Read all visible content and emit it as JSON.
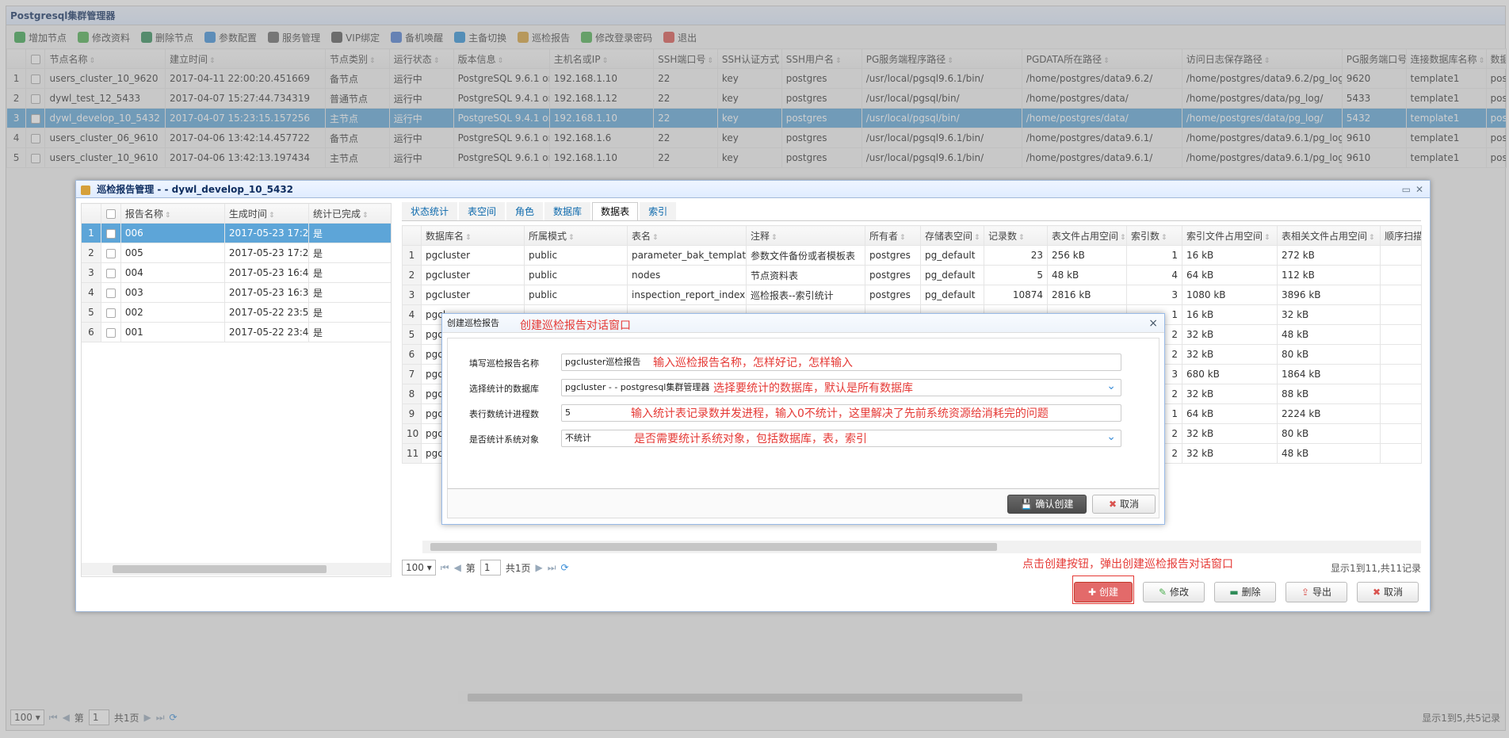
{
  "app": {
    "title": "Postgresql集群管理器"
  },
  "toolbar": [
    {
      "label": "增加节点",
      "icon": "add-icon",
      "color": "#3aa64f"
    },
    {
      "label": "修改资料",
      "icon": "pencil-icon",
      "color": "#4caf50"
    },
    {
      "label": "删除节点",
      "icon": "remove-icon",
      "color": "#2e8b57"
    },
    {
      "label": "参数配置",
      "icon": "gear-icon",
      "color": "#3b8ed8"
    },
    {
      "label": "服务管理",
      "icon": "server-icon",
      "color": "#666666"
    },
    {
      "label": "VIP绑定",
      "icon": "pin-icon",
      "color": "#555555"
    },
    {
      "label": "备机唤醒",
      "icon": "lamp-icon",
      "color": "#4a7bd0"
    },
    {
      "label": "主备切换",
      "icon": "switch-icon",
      "color": "#2b8fd6"
    },
    {
      "label": "巡检报告",
      "icon": "report-icon",
      "color": "#d6a03a"
    },
    {
      "label": "修改登录密码",
      "icon": "check-icon",
      "color": "#4caf50"
    },
    {
      "label": "退出",
      "icon": "exit-icon",
      "color": "#d9534f"
    }
  ],
  "node_grid": {
    "columns": [
      "节点名称",
      "建立时间",
      "节点类别",
      "运行状态",
      "版本信息",
      "主机名或IP",
      "SSH端口号",
      "SSH认证方式",
      "SSH用户名",
      "PG服务端程序路径",
      "PGDATA所在路径",
      "访问日志保存路径",
      "PG服务端口号",
      "连接数据库名称",
      "数据"
    ],
    "rows": [
      {
        "n": "1",
        "cells": [
          "users_cluster_10_9620",
          "2017-04-11 22:00:20.451669",
          "备节点",
          "运行中",
          "PostgreSQL 9.6.1 on",
          "192.168.1.10",
          "22",
          "key",
          "postgres",
          "/usr/local/pgsql9.6.1/bin/",
          "/home/postgres/data9.6.2/",
          "/home/postgres/data9.6.2/pg_log",
          "9620",
          "template1",
          "post"
        ]
      },
      {
        "n": "2",
        "cells": [
          "dywl_test_12_5433",
          "2017-04-07 15:27:44.734319",
          "普通节点",
          "运行中",
          "PostgreSQL 9.4.1 on",
          "192.168.1.12",
          "22",
          "key",
          "postgres",
          "/usr/local/pgsql/bin/",
          "/home/postgres/data/",
          "/home/postgres/data/pg_log/",
          "5433",
          "template1",
          "post"
        ]
      },
      {
        "n": "3",
        "cells": [
          "dywl_develop_10_5432",
          "2017-04-07 15:23:15.157256",
          "主节点",
          "运行中",
          "PostgreSQL 9.4.1 on",
          "192.168.1.10",
          "22",
          "key",
          "postgres",
          "/usr/local/pgsql/bin/",
          "/home/postgres/data/",
          "/home/postgres/data/pg_log/",
          "5432",
          "template1",
          "post"
        ]
      },
      {
        "n": "4",
        "cells": [
          "users_cluster_06_9610",
          "2017-04-06 13:42:14.457722",
          "备节点",
          "运行中",
          "PostgreSQL 9.6.1 on",
          "192.168.1.6",
          "22",
          "key",
          "postgres",
          "/usr/local/pgsql9.6.1/bin/",
          "/home/postgres/data9.6.1/",
          "/home/postgres/data9.6.1/pg_log",
          "9610",
          "template1",
          "post"
        ]
      },
      {
        "n": "5",
        "cells": [
          "users_cluster_10_9610",
          "2017-04-06 13:42:13.197434",
          "主节点",
          "运行中",
          "PostgreSQL 9.6.1 on",
          "192.168.1.10",
          "22",
          "key",
          "postgres",
          "/usr/local/pgsql9.6.1/bin/",
          "/home/postgres/data9.6.1/",
          "/home/postgres/data9.6.1/pg_log",
          "9610",
          "template1",
          "post"
        ]
      }
    ]
  },
  "bottom_pager": {
    "page_size": "100",
    "page_prefix": "第",
    "page": "1",
    "page_suffix": "共1页",
    "summary": "显示1到5,共5记录"
  },
  "report_panel": {
    "title": "巡检报告管理 -  - dywl_develop_10_5432",
    "report_columns": [
      "报告名称",
      "生成时间",
      "统计已完成"
    ],
    "reports": [
      {
        "n": "1",
        "name": "006",
        "time": "2017-05-23 17:2",
        "done": "是"
      },
      {
        "n": "2",
        "name": "005",
        "time": "2017-05-23 17:2",
        "done": "是"
      },
      {
        "n": "3",
        "name": "004",
        "time": "2017-05-23 16:4",
        "done": "是"
      },
      {
        "n": "4",
        "name": "003",
        "time": "2017-05-23 16:3",
        "done": "是"
      },
      {
        "n": "5",
        "name": "002",
        "time": "2017-05-22 23:5",
        "done": "是"
      },
      {
        "n": "6",
        "name": "001",
        "time": "2017-05-22 23:4",
        "done": "是"
      }
    ],
    "tabs": [
      "状态统计",
      "表空间",
      "角色",
      "数据库",
      "数据表",
      "索引"
    ],
    "active_tab": 4,
    "table_columns": [
      "数据库名",
      "所属模式",
      "表名",
      "注释",
      "所有者",
      "存储表空间",
      "记录数",
      "表文件占用空间",
      "索引数",
      "索引文件占用空间",
      "表相关文件占用空间",
      "顺序扫描次"
    ],
    "tables": [
      {
        "n": "1",
        "cells": [
          "pgcluster",
          "public",
          "parameter_bak_template",
          "参数文件备份或者模板表",
          "postgres",
          "pg_default",
          "23",
          "256 kB",
          "1",
          "16 kB",
          "272 kB",
          ""
        ]
      },
      {
        "n": "2",
        "cells": [
          "pgcluster",
          "public",
          "nodes",
          "节点资料表",
          "postgres",
          "pg_default",
          "5",
          "48 kB",
          "4",
          "64 kB",
          "112 kB",
          ""
        ]
      },
      {
        "n": "3",
        "cells": [
          "pgcluster",
          "public",
          "inspection_report_index",
          "巡检报表--索引统计",
          "postgres",
          "pg_default",
          "10874",
          "2816 kB",
          "3",
          "1080 kB",
          "3896 kB",
          ""
        ]
      },
      {
        "n": "4",
        "cells": [
          "pgcl",
          "",
          "",
          "",
          "",
          "",
          "",
          "",
          "1",
          "16 kB",
          "32 kB",
          ""
        ]
      },
      {
        "n": "5",
        "cells": [
          "pgc",
          "",
          "",
          "",
          "",
          "",
          "",
          "",
          "2",
          "32 kB",
          "48 kB",
          ""
        ]
      },
      {
        "n": "6",
        "cells": [
          "pgc",
          "",
          "",
          "",
          "",
          "",
          "",
          "",
          "2",
          "32 kB",
          "80 kB",
          ""
        ]
      },
      {
        "n": "7",
        "cells": [
          "pgc",
          "",
          "",
          "",
          "",
          "",
          "",
          "",
          "3",
          "680 kB",
          "1864 kB",
          ""
        ]
      },
      {
        "n": "8",
        "cells": [
          "pgc",
          "",
          "",
          "",
          "",
          "",
          "",
          "",
          "2",
          "32 kB",
          "88 kB",
          ""
        ]
      },
      {
        "n": "9",
        "cells": [
          "pgc",
          "",
          "",
          "",
          "",
          "",
          "",
          "",
          "1",
          "64 kB",
          "2224 kB",
          ""
        ]
      },
      {
        "n": "10",
        "cells": [
          "pgc",
          "",
          "",
          "",
          "",
          "",
          "",
          "",
          "2",
          "32 kB",
          "80 kB",
          ""
        ]
      },
      {
        "n": "11",
        "cells": [
          "pgc",
          "",
          "",
          "",
          "",
          "",
          "",
          "",
          "2",
          "32 kB",
          "48 kB",
          ""
        ]
      }
    ],
    "pager": {
      "page_size": "100",
      "page_prefix": "第",
      "page": "1",
      "page_suffix": "共1页",
      "summary": "显示1到11,共11记录"
    },
    "buttons": {
      "create": "创建",
      "edit": "修改",
      "delete": "删除",
      "export": "导出",
      "cancel": "取消"
    },
    "create_note": "点击创建按钮，弹出创建巡检报告对话窗口"
  },
  "dialog": {
    "title": "创建巡检报告",
    "title_note": "创建巡检报告对话窗口",
    "fields": [
      {
        "label": "填写巡检报告名称",
        "value": "pgcluster巡检报告",
        "note": "输入巡检报告名称，怎样好记，怎样输入",
        "dropdown": false
      },
      {
        "label": "选择统计的数据库",
        "value": "pgcluster -  - postgresql集群管理器",
        "note": "选择要统计的数据库，默认是所有数据库",
        "dropdown": true
      },
      {
        "label": "表行数统计进程数",
        "value": "5",
        "note": "输入统计表记录数并发进程，输入0不统计，这里解决了先前系统资源给消耗完的问题",
        "dropdown": false
      },
      {
        "label": "是否统计系统对象",
        "value": "不统计",
        "note": "是否需要统计系统对象，包括数据库，表，索引",
        "dropdown": true
      }
    ],
    "confirm_label": "确认创建",
    "cancel_label": "取消"
  }
}
